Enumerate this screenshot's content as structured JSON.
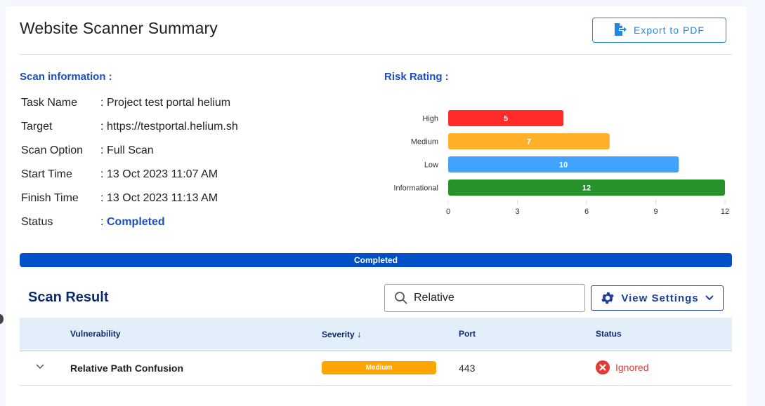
{
  "header": {
    "title": "Website Scanner Summary",
    "export_label": "Export to PDF"
  },
  "scan_info": {
    "heading": "Scan information :",
    "rows": [
      {
        "label": "Task Name",
        "value": "Project test portal helium"
      },
      {
        "label": "Target",
        "value": "https://testportal.helium.sh"
      },
      {
        "label": "Scan Option",
        "value": "Full Scan"
      },
      {
        "label": "Start Time",
        "value": "13 Oct 2023 11:07 AM"
      },
      {
        "label": "Finish Time",
        "value": "13 Oct 2023 11:13 AM"
      },
      {
        "label": "Status",
        "value": "Completed"
      }
    ],
    "colon": ":"
  },
  "risk": {
    "heading": "Risk Rating :"
  },
  "chart_data": {
    "type": "bar",
    "orientation": "horizontal",
    "title": "Risk Rating",
    "categories": [
      "High",
      "Medium",
      "Low",
      "Informational"
    ],
    "values": [
      5,
      7,
      10,
      12
    ],
    "colors": [
      "#ff2a2a",
      "#ffb02a",
      "#42a3ff",
      "#27922a"
    ],
    "xlim": [
      0,
      12
    ],
    "xticks": [
      0,
      3,
      6,
      9,
      12
    ],
    "xlabel": "",
    "ylabel": "",
    "data_labels": true,
    "grid": false
  },
  "progress": {
    "label": "Completed",
    "percent": 100,
    "color": "#0250c8"
  },
  "results": {
    "title": "Scan Result",
    "search_value": "Relative",
    "view_settings_label": "View Settings",
    "columns": [
      "Vulnerability",
      "Severity",
      "Port",
      "Status"
    ],
    "sort_indicator": "↓",
    "rows": [
      {
        "vulnerability": "Relative Path Confusion",
        "severity": "Medium",
        "port": "443",
        "status": "Ignored"
      }
    ]
  }
}
